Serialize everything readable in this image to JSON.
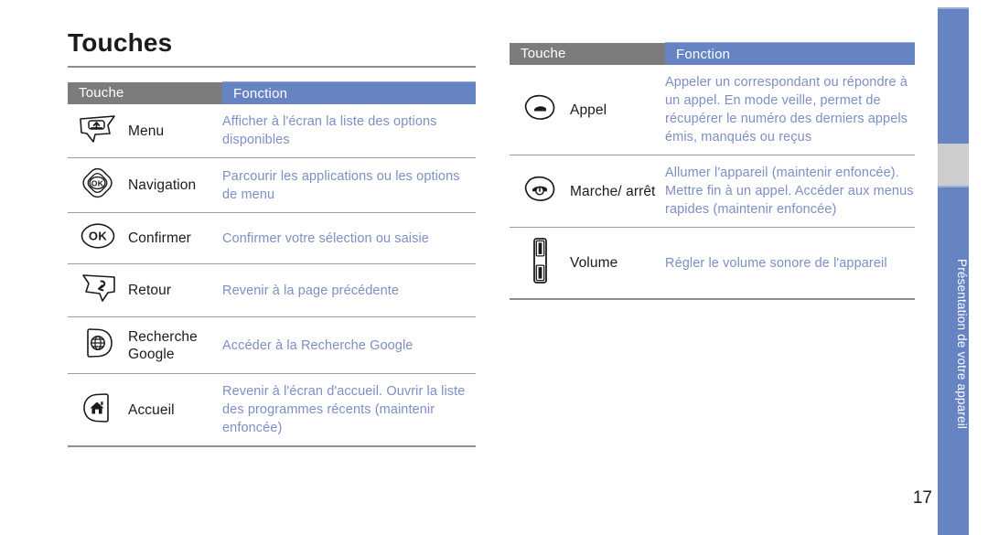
{
  "page": {
    "title": "Touches",
    "number": "17",
    "sidebar_label": "Présentation de votre appareil",
    "accent_blue": "#6683c4",
    "header_gray": "#7c7c7c",
    "function_text_color": "#7d8fc4"
  },
  "left_table": {
    "headers": {
      "touche": "Touche",
      "fonction": "Fonction"
    },
    "rows": [
      {
        "icon": "menu-key-icon",
        "name": "Menu",
        "function": "Afficher à l'écran la liste des options disponibles"
      },
      {
        "icon": "navigation-key-icon",
        "name": "Navigation",
        "function": "Parcourir les applications ou les options de menu"
      },
      {
        "icon": "confirm-ok-key-icon",
        "name": "Confirmer",
        "function": "Confirmer votre sélection ou saisie"
      },
      {
        "icon": "back-key-icon",
        "name": "Retour",
        "function": "Revenir à la page précédente"
      },
      {
        "icon": "google-search-key-icon",
        "name": "Recherche Google",
        "function": "Accéder à la Recherche Google"
      },
      {
        "icon": "home-key-icon",
        "name": "Accueil",
        "function": "Revenir à l'écran d'accueil. Ouvrir la liste des programmes récents (maintenir enfoncée)"
      }
    ]
  },
  "right_table": {
    "headers": {
      "touche": "Touche",
      "fonction": "Fonction"
    },
    "rows": [
      {
        "icon": "call-key-icon",
        "name": "Appel",
        "function": "Appeler un correspondant ou répondre à un appel. En mode veille, permet de récupérer le numéro des derniers appels émis, manqués ou reçus"
      },
      {
        "icon": "power-end-key-icon",
        "name": "Marche/ arrêt",
        "function": "Allumer l'appareil (maintenir enfoncée). Mettre fin à un appel. Accéder aux menus rapides (maintenir enfoncée)"
      },
      {
        "icon": "volume-key-icon",
        "name": "Volume",
        "function": "Régler le volume sonore de l'appareil"
      }
    ]
  }
}
